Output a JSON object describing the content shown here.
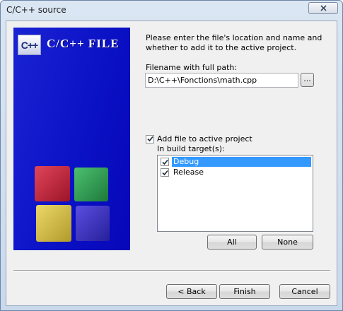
{
  "window": {
    "title": "C/C++ source",
    "close_icon": "close-icon"
  },
  "banner": {
    "logo_text": "C++",
    "title": "C/C++ FILE",
    "colors": {
      "background": "#0a10c4",
      "cube_red": "#c8283c",
      "cube_green": "#2f9b4f",
      "cube_yellow": "#d8c24a",
      "cube_purple": "#3a2fb8"
    }
  },
  "form": {
    "intro": "Please enter the file's location and name and whether to add it to the active project.",
    "filename_label": "Filename with full path:",
    "filename_value": "D:\\C++\\Fonctions\\math.cpp",
    "browse_label": "...",
    "add_to_project_label": "Add file to active project",
    "add_to_project_checked": true,
    "targets_label": "In build target(s):",
    "targets": [
      {
        "name": "Debug",
        "checked": true,
        "selected": true
      },
      {
        "name": "Release",
        "checked": true,
        "selected": false
      }
    ],
    "all_label": "All",
    "none_label": "None"
  },
  "footer": {
    "back_label": "< Back",
    "finish_label": "Finish",
    "cancel_label": "Cancel"
  }
}
